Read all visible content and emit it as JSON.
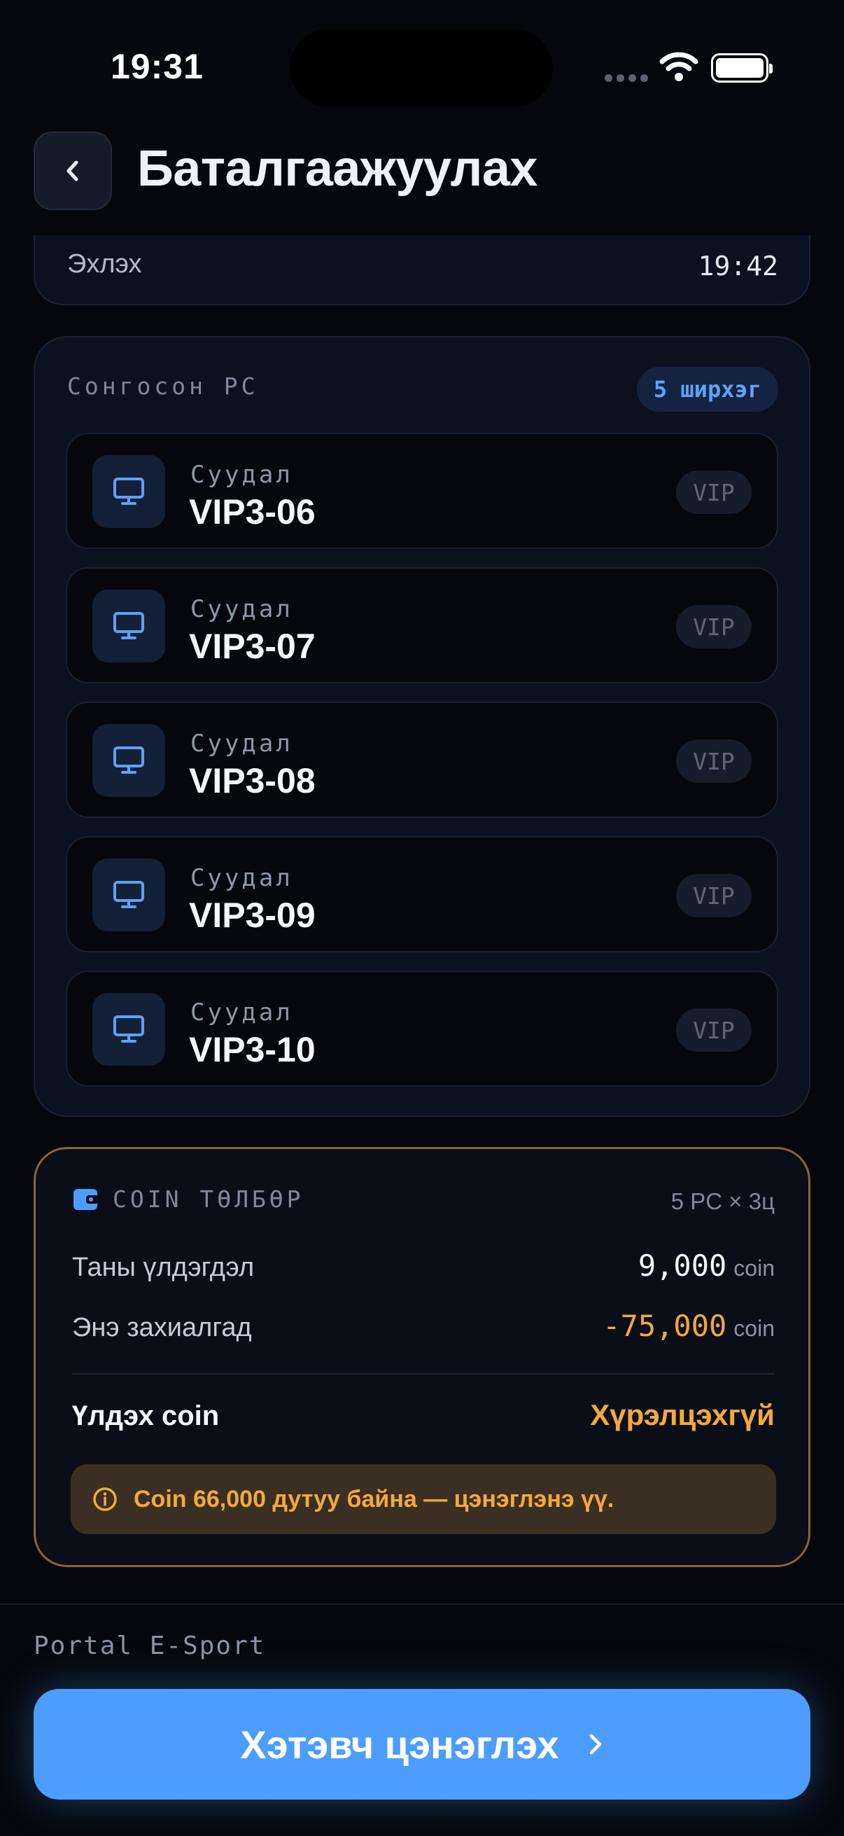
{
  "status_bar": {
    "time": "19:31"
  },
  "header": {
    "title": "Баталгаажуулах"
  },
  "top_card": {
    "label": "Эхлэх",
    "value": "19:42"
  },
  "pc_section": {
    "heading": "Сонгосон PC",
    "count": "5 ширхэг",
    "items": [
      {
        "sub": "Суудал",
        "name": "VIP3-06",
        "badge": "VIP"
      },
      {
        "sub": "Суудал",
        "name": "VIP3-07",
        "badge": "VIP"
      },
      {
        "sub": "Суудал",
        "name": "VIP3-08",
        "badge": "VIP"
      },
      {
        "sub": "Суудал",
        "name": "VIP3-09",
        "badge": "VIP"
      },
      {
        "sub": "Суудал",
        "name": "VIP3-10",
        "badge": "VIP"
      }
    ]
  },
  "coin": {
    "heading": "COIN ТӨЛБӨР",
    "formula": "5 PC × 3ц",
    "balance_label": "Таны үлдэгдэл",
    "balance_value": "9,000",
    "order_label": "Энэ захиалгад",
    "order_value": "-75,000",
    "unit": "coin",
    "remain_label": "Үлдэх coin",
    "remain_value": "Хүрэлцэхгүй",
    "warning": "Coin 66,000 дутуу байна — цэнэглэнэ үү."
  },
  "footer": {
    "brand": "Portal E-Sport",
    "cta_label": "Хэтэвч цэнэглэх"
  },
  "colors": {
    "accent": "#4c9dff",
    "warning": "#f5a93a",
    "background": "#05070c"
  }
}
